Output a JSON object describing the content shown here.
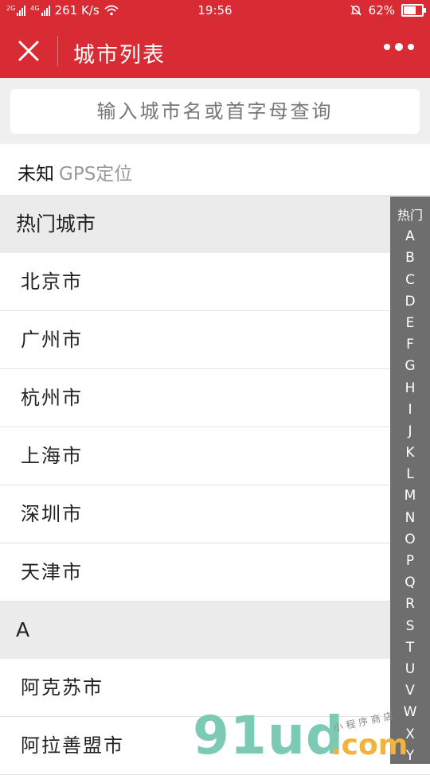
{
  "status_bar": {
    "net1": "2G",
    "net2": "4G",
    "speed": "261 K/s",
    "time": "19:56",
    "battery_text": "62%",
    "battery_level": 0.62
  },
  "navbar": {
    "title": "城市列表",
    "close_icon": "close-icon",
    "more_icon": "more-icon"
  },
  "search": {
    "placeholder": "输入城市名或首字母查询"
  },
  "location": {
    "city": "未知",
    "gps_label": "GPS定位"
  },
  "sections": [
    {
      "header": "热门城市",
      "cities": [
        "北京市",
        "广州市",
        "杭州市",
        "上海市",
        "深圳市",
        "天津市"
      ]
    },
    {
      "header": "A",
      "cities": [
        "阿克苏市",
        "阿拉善盟市"
      ]
    }
  ],
  "index": [
    "热门",
    "A",
    "B",
    "C",
    "D",
    "E",
    "F",
    "G",
    "H",
    "I",
    "J",
    "K",
    "L",
    "M",
    "N",
    "O",
    "P",
    "Q",
    "R",
    "S",
    "T",
    "U",
    "V",
    "W",
    "X",
    "Y"
  ],
  "watermark": {
    "logo": "91ud",
    "dotcom": ".com",
    "sub": "小程序商店"
  },
  "colors": {
    "brand": "#d92b33",
    "index_bg": "#6e6e6e",
    "section_bg": "#ebebeb"
  }
}
